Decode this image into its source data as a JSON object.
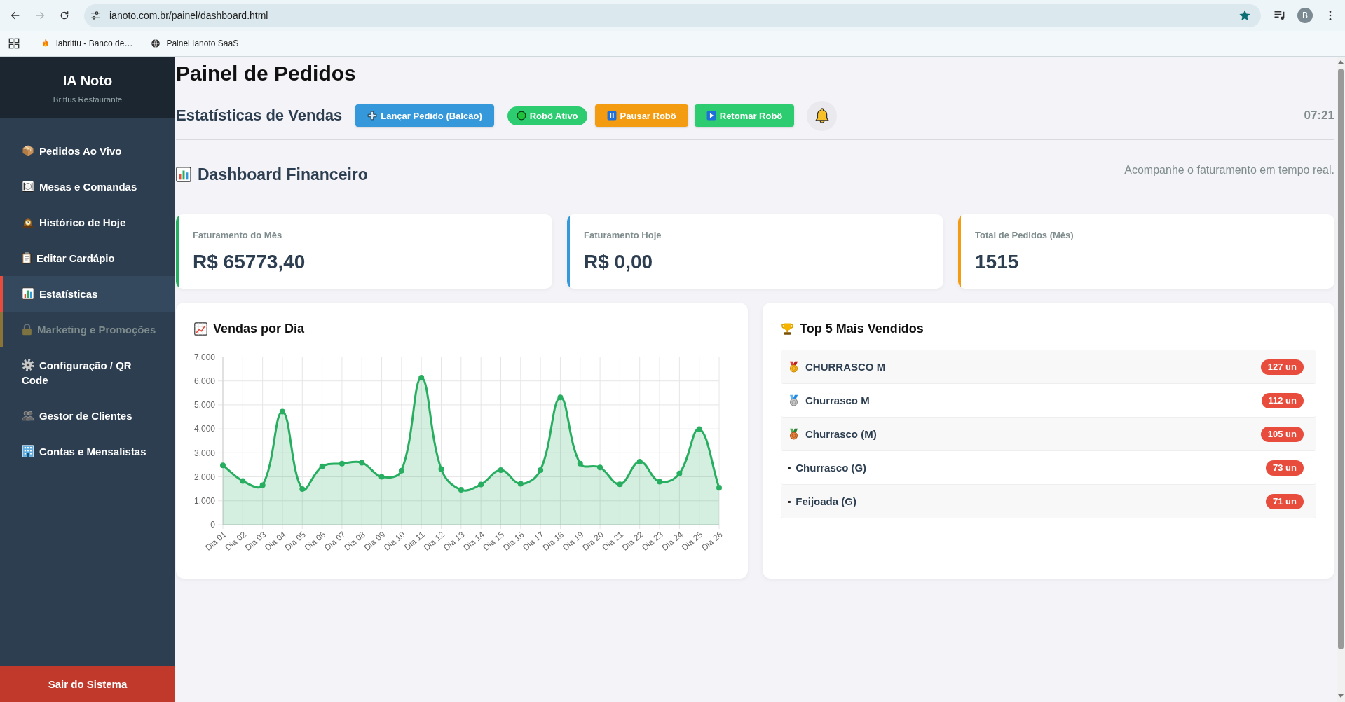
{
  "browser": {
    "nav": [
      {
        "kind": "back",
        "disabled": false
      },
      {
        "kind": "forward",
        "disabled": true
      },
      {
        "kind": "reload",
        "disabled": false
      }
    ],
    "url": "ianoto.com.br/painel/dashboard.html",
    "bookmarked": true,
    "profile_initial": "B",
    "bookmarks": [
      {
        "label": "iabrittu - Banco de…"
      },
      {
        "label": "Painel Ianoto SaaS"
      }
    ]
  },
  "sidebar": {
    "brand": "IA Noto",
    "subtitle": "Brittus Restaurante",
    "items": [
      {
        "label": "Pedidos Ao Vivo",
        "selected": false,
        "disabled": false
      },
      {
        "label": "Mesas e Comandas",
        "selected": false,
        "disabled": false
      },
      {
        "label": "Histórico de Hoje",
        "selected": false,
        "disabled": false
      },
      {
        "label": "Editar Cardápio",
        "selected": false,
        "disabled": false
      },
      {
        "label": "Estatísticas",
        "selected": true,
        "disabled": false
      },
      {
        "label": "Marketing e Promoções",
        "selected": false,
        "disabled": true
      },
      {
        "label": "Configuração / QR Code",
        "selected": false,
        "disabled": false
      },
      {
        "label": "Gestor de Clientes",
        "selected": false,
        "disabled": false
      },
      {
        "label": "Contas e Mensalistas",
        "selected": false,
        "disabled": false
      }
    ],
    "logout": "Sair do Sistema"
  },
  "header": {
    "title": "Painel de Pedidos",
    "section": "Estatísticas de Vendas",
    "buttons": [
      {
        "kind": "primary",
        "label": "Lançar Pedido (Balcão)"
      },
      {
        "kind": "status",
        "label": "Robô Ativo"
      },
      {
        "kind": "warning",
        "label": "Pausar Robô"
      },
      {
        "kind": "success",
        "label": "Retomar Robô"
      }
    ],
    "time": "07:21"
  },
  "dashboard": {
    "title": "Dashboard Financeiro",
    "subtitle": "Acompanhe o faturamento em tempo real."
  },
  "stats": [
    {
      "label": "Faturamento do Mês",
      "value": "R$ 65773,40",
      "color": "#27ae60"
    },
    {
      "label": "Faturamento Hoje",
      "value": "R$ 0,00",
      "color": "#3498db"
    },
    {
      "label": "Total de Pedidos (Mês)",
      "value": "1515",
      "color": "#f39c12"
    }
  ],
  "sales_chart": {
    "chart_data": {
      "type": "area",
      "title": "Vendas por Dia",
      "categories": [
        "Dia 01",
        "Dia 02",
        "Dia 03",
        "Dia 04",
        "Dia 05",
        "Dia 06",
        "Dia 07",
        "Dia 08",
        "Dia 09",
        "Dia 10",
        "Dia 11",
        "Dia 12",
        "Dia 13",
        "Dia 14",
        "Dia 15",
        "Dia 16",
        "Dia 17",
        "Dia 18",
        "Dia 19",
        "Dia 20",
        "Dia 21",
        "Dia 22",
        "Dia 23",
        "Dia 24",
        "Dia 25",
        "Dia 26"
      ],
      "values": [
        2480,
        1830,
        1650,
        4720,
        1490,
        2430,
        2550,
        2590,
        2000,
        2260,
        6140,
        2320,
        1460,
        1680,
        2280,
        1710,
        2280,
        5310,
        2550,
        2390,
        1690,
        2630,
        1800,
        2140,
        3990,
        1540
      ],
      "ylim": [
        0,
        7000
      ],
      "yticks": [
        {
          "value": 0,
          "label": "0"
        },
        {
          "value": 1000,
          "label": "1.000"
        },
        {
          "value": 2000,
          "label": "2.000"
        },
        {
          "value": 3000,
          "label": "3.000"
        },
        {
          "value": 4000,
          "label": "4.000"
        },
        {
          "value": 5000,
          "label": "5.000"
        },
        {
          "value": 6000,
          "label": "6.000"
        },
        {
          "value": 7000,
          "label": "7.000"
        }
      ],
      "grid": true
    }
  },
  "top_products": {
    "title": "Top 5 Mais Vendidos",
    "items": [
      {
        "kind": "gold",
        "name": "CHURRASCO M",
        "count": "127 un"
      },
      {
        "kind": "silver",
        "name": "Churrasco M",
        "count": "112 un"
      },
      {
        "kind": "bronze",
        "name": "Churrasco (M)",
        "count": "105 un"
      },
      {
        "kind": "bullet",
        "marker": "▪",
        "name": "Churrasco (G)",
        "count": "73 un"
      },
      {
        "kind": "bullet",
        "marker": "▪",
        "name": "Feijoada (G)",
        "count": "71 un"
      }
    ]
  }
}
